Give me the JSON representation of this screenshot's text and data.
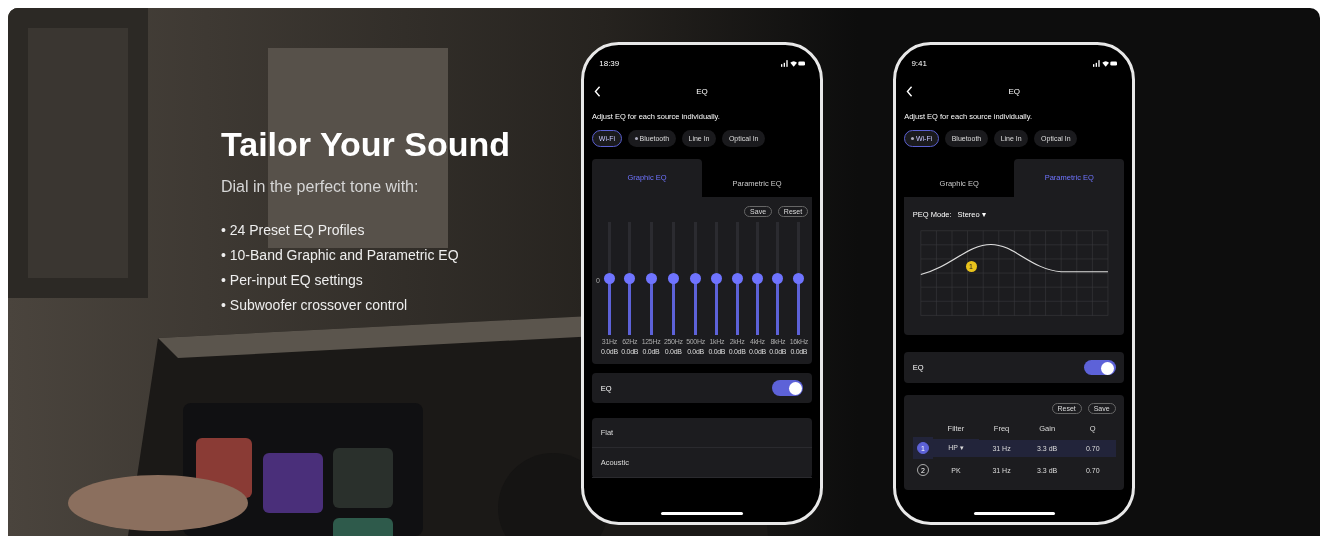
{
  "hero": {
    "title": "Tailor Your Sound",
    "subtitle": "Dial in the perfect tone with:",
    "features": [
      "• 24 Preset EQ Profiles",
      "• 10-Band Graphic and Parametric EQ",
      "• Per-input EQ settings",
      "• Subwoofer crossover control"
    ]
  },
  "phones": [
    {
      "kind": "graphic",
      "time": "18:39",
      "title": "EQ",
      "subtitle": "Adjust EQ for each source individually.",
      "sources": [
        {
          "label": "Wi-Fi",
          "selected": true,
          "dot": false
        },
        {
          "label": "Bluetooth",
          "selected": false,
          "dot": true
        },
        {
          "label": "Line In",
          "selected": false,
          "dot": false
        },
        {
          "label": "Optical In",
          "selected": false,
          "dot": false
        }
      ],
      "tabs": [
        {
          "label": "Graphic EQ",
          "selected": true
        },
        {
          "label": "Parametric EQ",
          "selected": false
        }
      ],
      "actions": [
        "Save",
        "Reset"
      ],
      "zero_label": "0",
      "bands": [
        {
          "freq": "31Hz",
          "gain": "0.0dB",
          "level": 0.5
        },
        {
          "freq": "62Hz",
          "gain": "0.0dB",
          "level": 0.5
        },
        {
          "freq": "125Hz",
          "gain": "0.0dB",
          "level": 0.5
        },
        {
          "freq": "250Hz",
          "gain": "0.0dB",
          "level": 0.5
        },
        {
          "freq": "500Hz",
          "gain": "0.0dB",
          "level": 0.5
        },
        {
          "freq": "1kHz",
          "gain": "0.0dB",
          "level": 0.5
        },
        {
          "freq": "2kHz",
          "gain": "0.0dB",
          "level": 0.5
        },
        {
          "freq": "4kHz",
          "gain": "0.0dB",
          "level": 0.5
        },
        {
          "freq": "8kHz",
          "gain": "0.0dB",
          "level": 0.5
        },
        {
          "freq": "16kHz",
          "gain": "0.0dB",
          "level": 0.5
        }
      ],
      "eq_toggle": {
        "label": "EQ",
        "on": true
      },
      "presets": [
        "Flat",
        "Acoustic"
      ]
    },
    {
      "kind": "parametric",
      "time": "9:41",
      "title": "EQ",
      "subtitle": "Adjust EQ for each source individually.",
      "sources": [
        {
          "label": "Wi-Fi",
          "selected": true,
          "dot": true
        },
        {
          "label": "Bluetooth",
          "selected": false,
          "dot": false
        },
        {
          "label": "Line In",
          "selected": false,
          "dot": false
        },
        {
          "label": "Optical In",
          "selected": false,
          "dot": false
        }
      ],
      "tabs": [
        {
          "label": "Graphic EQ",
          "selected": false
        },
        {
          "label": "Parametric EQ",
          "selected": true
        }
      ],
      "mode_label": "PEQ Mode:",
      "mode_value": "Stereo ▾",
      "point_label": "1",
      "eq_toggle": {
        "label": "EQ",
        "on": true
      },
      "actions": [
        "Reset",
        "Save"
      ],
      "columns": [
        "Filter",
        "Freq",
        "Gain",
        "Q"
      ],
      "filters": [
        {
          "index": "1",
          "type": "HP ▾",
          "freq": "31 Hz",
          "gain": "3.3 dB",
          "q": "0.70",
          "selected": true
        },
        {
          "index": "2",
          "type": "PK",
          "freq": "31 Hz",
          "gain": "3.3 dB",
          "q": "0.70",
          "selected": false
        }
      ]
    }
  ]
}
